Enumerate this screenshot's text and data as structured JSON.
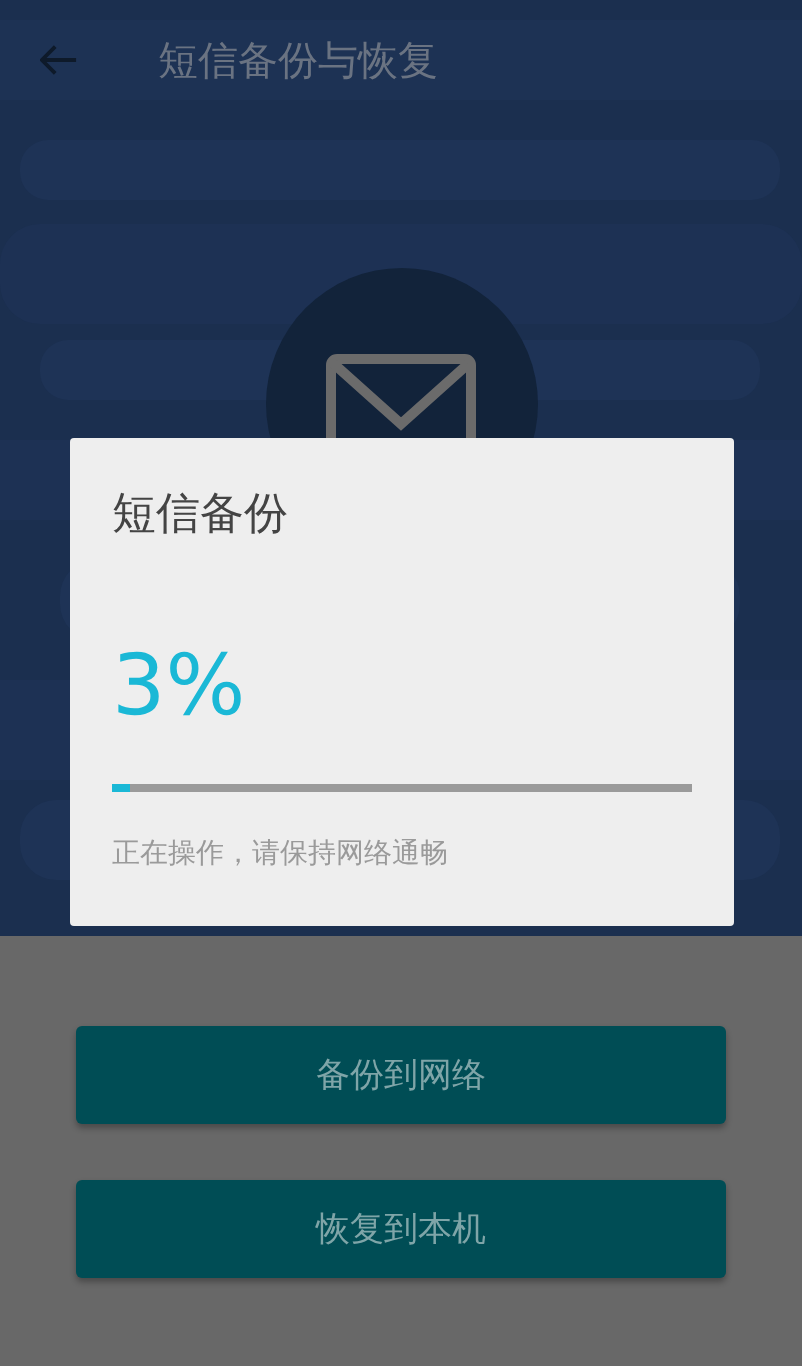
{
  "app_bar": {
    "title": "短信备份与恢复"
  },
  "dialog": {
    "title": "短信备份",
    "percent": "3%",
    "progress": {
      "level": 0.03
    },
    "message": "正在操作，请保持网络通畅"
  },
  "buttons": [
    {
      "label": "备份到网络"
    },
    {
      "label": "恢复到本机"
    }
  ]
}
